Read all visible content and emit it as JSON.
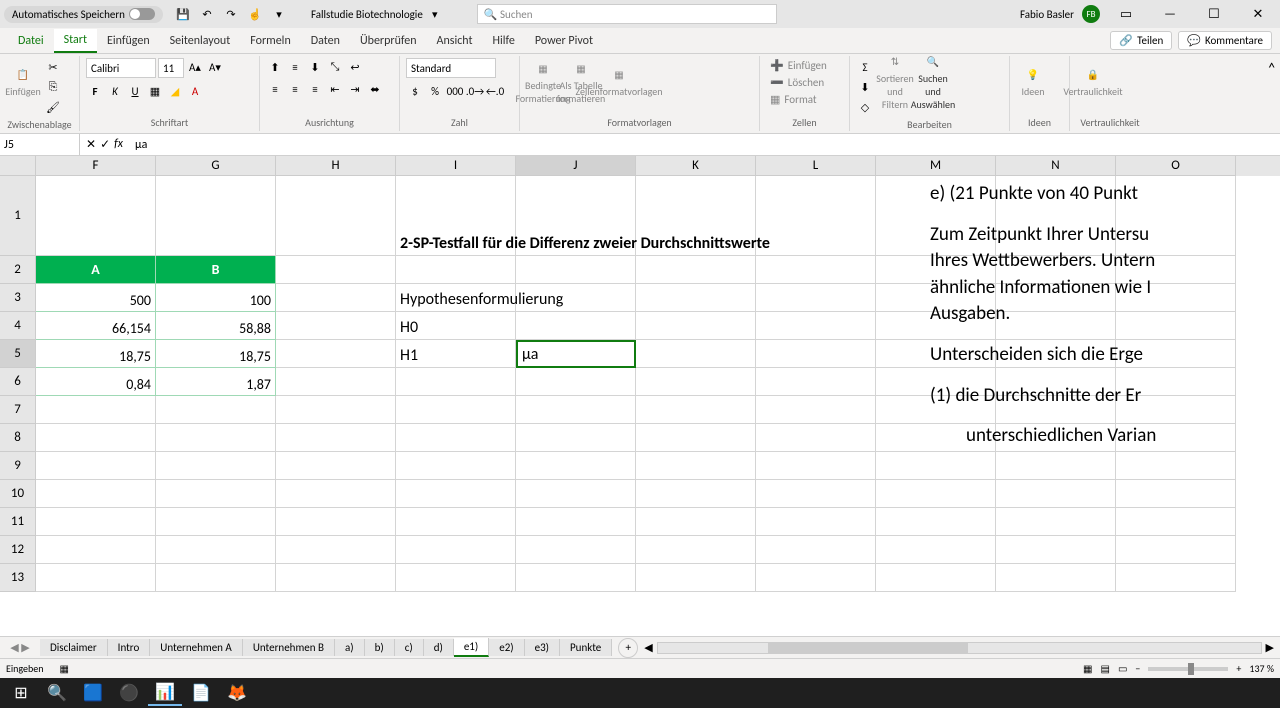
{
  "titlebar": {
    "auto_save": "Automatisches Speichern",
    "doc_title": "Fallstudie Biotechnologie",
    "search_placeholder": "Suchen",
    "user_name": "Fabio Basler",
    "user_initials": "FB"
  },
  "tabs": {
    "items": [
      "Datei",
      "Start",
      "Einfügen",
      "Seitenlayout",
      "Formeln",
      "Daten",
      "Überprüfen",
      "Ansicht",
      "Hilfe",
      "Power Pivot"
    ],
    "active": "Start",
    "share": "Teilen",
    "comments": "Kommentare"
  },
  "ribbon": {
    "clipboard": {
      "paste": "Einfügen",
      "label": "Zwischenablage"
    },
    "font": {
      "name": "Calibri",
      "size": "11",
      "label": "Schriftart"
    },
    "align": {
      "label": "Ausrichtung"
    },
    "number": {
      "format": "Standard",
      "label": "Zahl"
    },
    "styles": {
      "cond": "Bedingte Formatierung",
      "table": "Als Tabelle formatieren",
      "cellstyles": "Zellenformatvorlagen",
      "label": "Formatvorlagen"
    },
    "cells": {
      "insert": "Einfügen",
      "delete": "Löschen",
      "format": "Format",
      "label": "Zellen"
    },
    "editing": {
      "sort": "Sortieren und Filtern",
      "find": "Suchen und Auswählen",
      "label": "Bearbeiten"
    },
    "ideas": {
      "btn": "Ideen",
      "label": "Ideen"
    },
    "sens": {
      "btn": "Vertraulichkeit",
      "label": "Vertraulichkeit"
    }
  },
  "formula": {
    "name_box": "J5",
    "content": "μa"
  },
  "columns": [
    "F",
    "G",
    "H",
    "I",
    "J",
    "K",
    "L",
    "M",
    "N",
    "O"
  ],
  "rows": [
    "1",
    "2",
    "3",
    "4",
    "5",
    "6",
    "7",
    "8",
    "9",
    "10",
    "11",
    "12",
    "13"
  ],
  "cells": {
    "title": "2-SP-Testfall für die Differenz zweier Durchschnittswerte",
    "hdrA": "A",
    "hdrB": "B",
    "F3": "500",
    "G3": "100",
    "F4": "66,154",
    "G4": "58,88",
    "F5": "18,75",
    "G5": "18,75",
    "F6": "0,84",
    "G6": "1,87",
    "I3": "Hypothesenformulierung",
    "I4": "H0",
    "I5": "H1",
    "J5": "μa"
  },
  "right_text": {
    "l1": "e)   (21 Punkte von 40 Punkt",
    "l2": "Zum Zeitpunkt Ihrer Untersu",
    "l3": "Ihres Wettbewerbers. Untern",
    "l4": "ähnliche Informationen wie I",
    "l5": "Ausgaben.",
    "l6": "Unterscheiden sich die Erge",
    "l7": "(1)  die Durchschnitte der Er",
    "l8": "unterschiedlichen Varian"
  },
  "sheets": {
    "items": [
      "Disclaimer",
      "Intro",
      "Unternehmen A",
      "Unternehmen B",
      "a)",
      "b)",
      "c)",
      "d)",
      "e1)",
      "e2)",
      "e3)",
      "Punkte"
    ],
    "active": "e1)"
  },
  "status": {
    "mode": "Eingeben",
    "zoom": "137 %"
  },
  "chart_data": {
    "type": "table",
    "title": "2-SP-Testfall für die Differenz zweier Durchschnittswerte",
    "columns": [
      "A",
      "B"
    ],
    "rows": [
      [
        500,
        100
      ],
      [
        66.154,
        58.88
      ],
      [
        18.75,
        18.75
      ],
      [
        0.84,
        1.87
      ]
    ]
  }
}
